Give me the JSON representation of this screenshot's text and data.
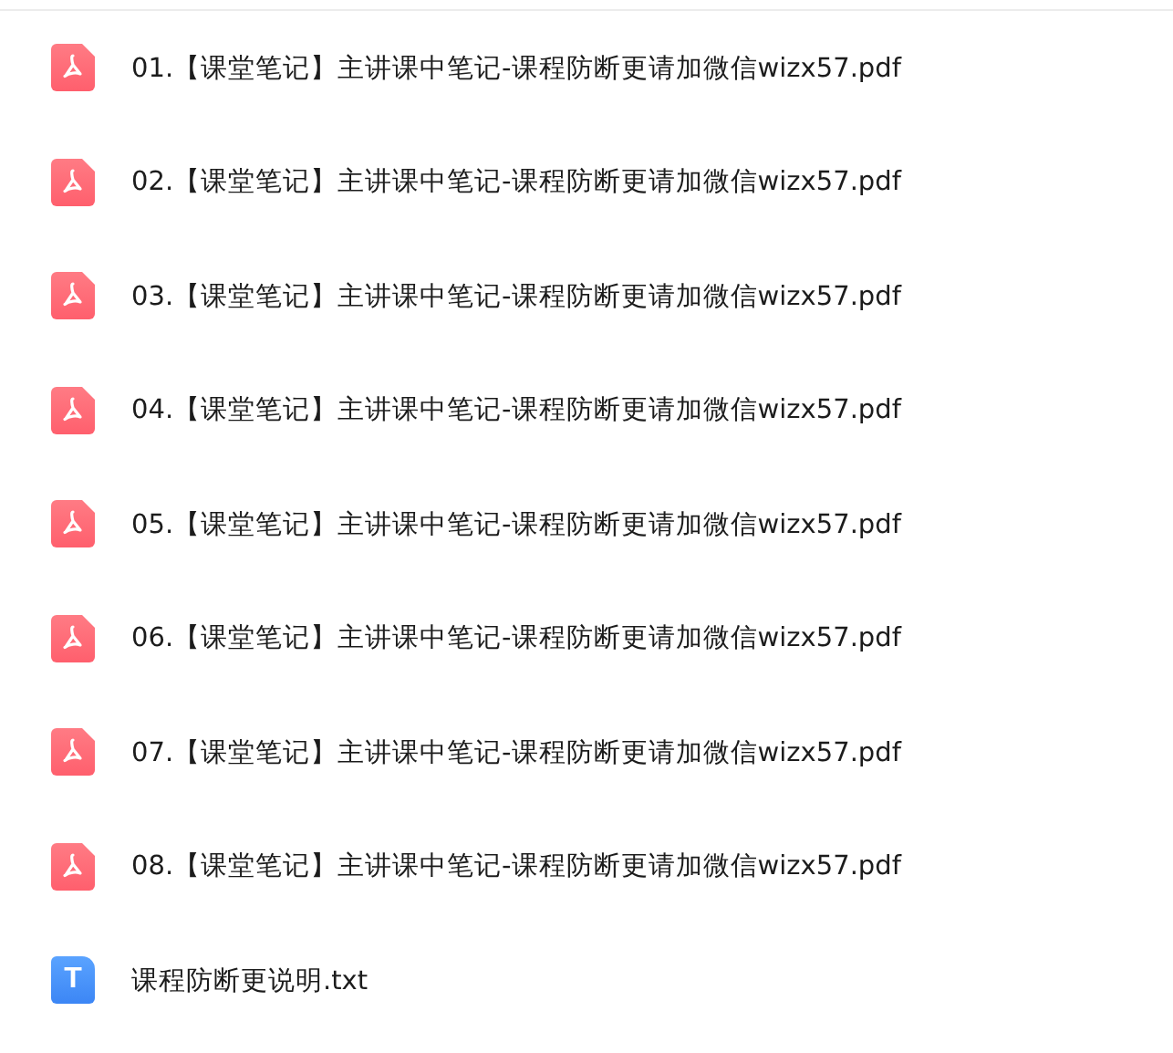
{
  "files": [
    {
      "kind": "pdf",
      "name": "01.【课堂笔记】主讲课中笔记-课程防断更请加微信wizx57.pdf"
    },
    {
      "kind": "pdf",
      "name": "02.【课堂笔记】主讲课中笔记-课程防断更请加微信wizx57.pdf"
    },
    {
      "kind": "pdf",
      "name": "03.【课堂笔记】主讲课中笔记-课程防断更请加微信wizx57.pdf"
    },
    {
      "kind": "pdf",
      "name": "04.【课堂笔记】主讲课中笔记-课程防断更请加微信wizx57.pdf"
    },
    {
      "kind": "pdf",
      "name": "05.【课堂笔记】主讲课中笔记-课程防断更请加微信wizx57.pdf"
    },
    {
      "kind": "pdf",
      "name": "06.【课堂笔记】主讲课中笔记-课程防断更请加微信wizx57.pdf"
    },
    {
      "kind": "pdf",
      "name": "07.【课堂笔记】主讲课中笔记-课程防断更请加微信wizx57.pdf"
    },
    {
      "kind": "pdf",
      "name": "08.【课堂笔记】主讲课中笔记-课程防断更请加微信wizx57.pdf"
    },
    {
      "kind": "txt",
      "name": "课程防断更说明.txt",
      "icon_letter": "T"
    }
  ]
}
